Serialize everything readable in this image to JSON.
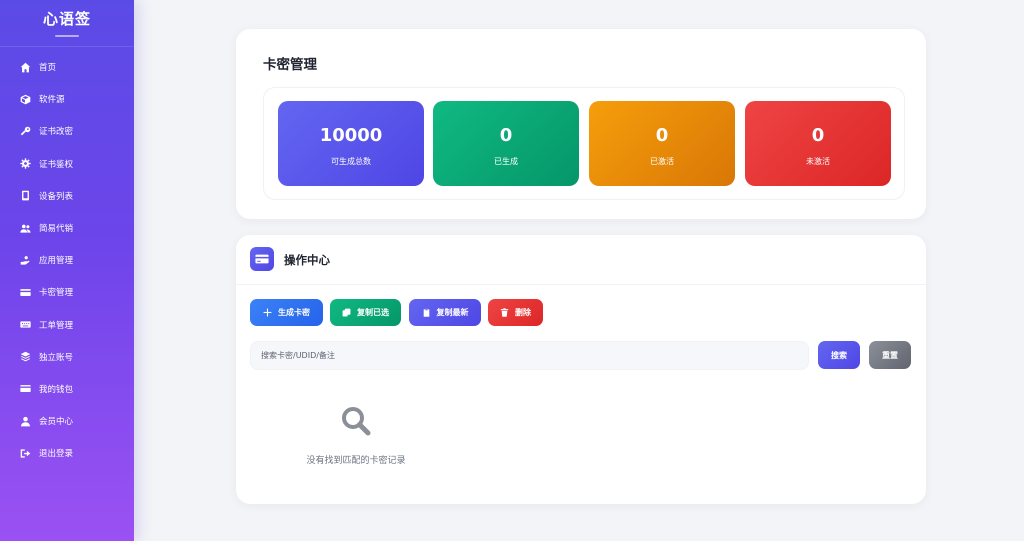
{
  "sidebar": {
    "brand": "心语签",
    "items": [
      {
        "label": "首页",
        "icon": "home-icon"
      },
      {
        "label": "软件源",
        "icon": "box-icon"
      },
      {
        "label": "证书改密",
        "icon": "key-icon"
      },
      {
        "label": "证书鉴权",
        "icon": "gear-icon"
      },
      {
        "label": "设备列表",
        "icon": "mobile-icon"
      },
      {
        "label": "简易代销",
        "icon": "users-icon"
      },
      {
        "label": "应用管理",
        "icon": "hand-icon"
      },
      {
        "label": "卡密管理",
        "icon": "card-icon"
      },
      {
        "label": "工单管理",
        "icon": "keyboard-icon"
      },
      {
        "label": "独立账号",
        "icon": "layers-icon"
      },
      {
        "label": "我的钱包",
        "icon": "wallet-icon"
      },
      {
        "label": "会员中心",
        "icon": "user-icon"
      },
      {
        "label": "退出登录",
        "icon": "logout-icon"
      }
    ]
  },
  "card_mgmt": {
    "title": "卡密管理",
    "stats": [
      {
        "value": "10000",
        "label": "可生成总数"
      },
      {
        "value": "0",
        "label": "已生成"
      },
      {
        "value": "0",
        "label": "已激活"
      },
      {
        "value": "0",
        "label": "未激活"
      }
    ]
  },
  "operations": {
    "title": "操作中心",
    "buttons": {
      "generate": "生成卡密",
      "copy_selected": "复制已选",
      "copy_latest": "复制最新",
      "delete": "删除"
    },
    "search": {
      "placeholder": "搜索卡密/UDID/备注",
      "search_label": "搜索",
      "reset_label": "重置"
    },
    "empty_text": "没有找到匹配的卡密记录"
  },
  "colors": {
    "accent": "#4f46e5",
    "success": "#059669",
    "warning": "#d97706",
    "danger": "#dc2626",
    "info": "#2563eb"
  }
}
